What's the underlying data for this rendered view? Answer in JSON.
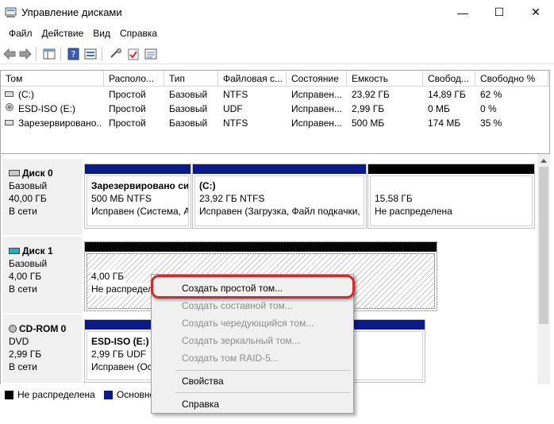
{
  "window": {
    "title": "Управление дисками",
    "minimize": "—",
    "maximize": "☐",
    "close": "✕"
  },
  "menu": [
    "Файл",
    "Действие",
    "Вид",
    "Справка"
  ],
  "volume_table": {
    "columns": [
      "Том",
      "Располо...",
      "Тип",
      "Файловая с...",
      "Состояние",
      "Емкость",
      "Свобод...",
      "Свободно %"
    ],
    "rows": [
      {
        "icon": "drive-icon",
        "cells": [
          "(C:)",
          "Простой",
          "Базовый",
          "NTFS",
          "Исправен...",
          "23,92 ГБ",
          "14,89 ГБ",
          "62 %"
        ]
      },
      {
        "icon": "cd-icon",
        "cells": [
          "ESD-ISO (E:)",
          "Простой",
          "Базовый",
          "UDF",
          "Исправен...",
          "2,99 ГБ",
          "0 МБ",
          "0 %"
        ]
      },
      {
        "icon": "drive-icon",
        "cells": [
          "Зарезервировано...",
          "Простой",
          "Базовый",
          "NTFS",
          "Исправен...",
          "500 МБ",
          "174 МБ",
          "35 %"
        ]
      }
    ]
  },
  "disks": [
    {
      "name": "Диск 0",
      "type": "Базовый",
      "size": "40,00 ГБ",
      "status": "В сети",
      "partitions": [
        {
          "title": "Зарезервировано си",
          "size": "500 МБ NTFS",
          "status": "Исправен (Система, А"
        },
        {
          "title": "(C:)",
          "size": "23,92 ГБ NTFS",
          "status": "Исправен (Загрузка, Файл подкачки,"
        },
        {
          "title": "",
          "size": "15,58 ГБ",
          "status": "Не распределена"
        }
      ]
    },
    {
      "name": "Диск 1",
      "type": "Базовый",
      "size": "4,00 ГБ",
      "status": "В сети",
      "partitions": [
        {
          "title": "",
          "size": "4,00 ГБ",
          "status": "Не распределен"
        }
      ]
    },
    {
      "name": "CD-ROM 0",
      "type": "DVD",
      "size": "2,99 ГБ",
      "status": "В сети",
      "partitions": [
        {
          "title": "ESD-ISO  (E:)",
          "size": "2,99 ГБ UDF",
          "status": "Исправен (Осн"
        }
      ]
    }
  ],
  "legend": [
    {
      "label": "Не распределена",
      "color": "#000000"
    },
    {
      "label": "Основной",
      "color": "#0a1a8c"
    }
  ],
  "context_menu": {
    "items": [
      {
        "label": "Создать простой том...",
        "enabled": true
      },
      {
        "label": "Создать составной том...",
        "enabled": false
      },
      {
        "label": "Создать чередующийся том...",
        "enabled": false
      },
      {
        "label": "Создать зеркальный том...",
        "enabled": false
      },
      {
        "label": "Создать том RAID-5...",
        "enabled": false
      },
      {
        "label": "Свойства",
        "enabled": true
      },
      {
        "label": "Справка",
        "enabled": true
      }
    ]
  },
  "colors": {
    "primary_bar": "#0a1a8c",
    "unallocated_bar": "#000000",
    "highlight": "#d6272a"
  }
}
